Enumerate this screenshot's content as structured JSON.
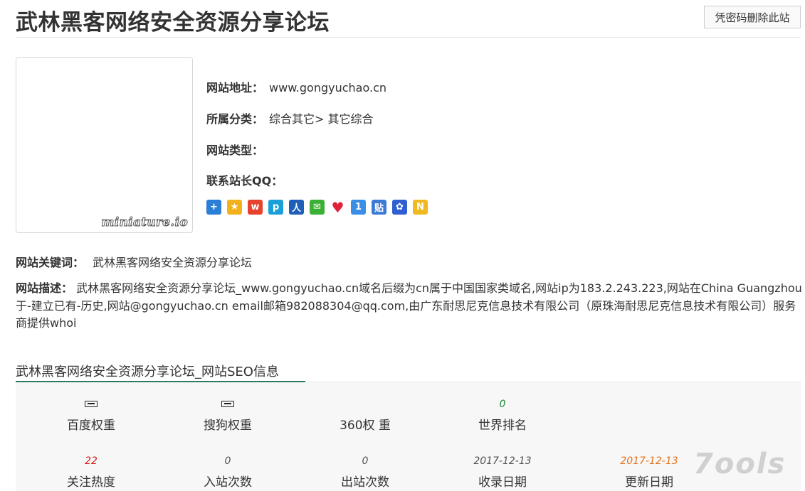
{
  "header": {
    "title": "武林黑客网络安全资源分享论坛",
    "delete_button": "凭密码删除此站"
  },
  "thumbnail": {
    "watermark": "miniature.io"
  },
  "info": {
    "address_label": "网站地址：",
    "address_value": "www.gongyuchao.cn",
    "category_label": "所属分类：",
    "category_value": "综合其它> 其它综合",
    "type_label": "网站类型：",
    "qq_label": "联系站长QQ："
  },
  "share_icons": [
    {
      "icon": "plus-share-icon",
      "glyph": "+",
      "color": "#2a7fd6"
    },
    {
      "icon": "qzone-icon",
      "glyph": "★",
      "color": "#f2b21c"
    },
    {
      "icon": "weibo-icon",
      "glyph": "w",
      "color": "#e6432e"
    },
    {
      "icon": "tqq-icon",
      "glyph": "p",
      "color": "#1a9fd8"
    },
    {
      "icon": "renren-icon",
      "glyph": "人",
      "color": "#1f5fb8"
    },
    {
      "icon": "wechat-icon",
      "glyph": "✉",
      "color": "#3cb034"
    },
    {
      "icon": "heart-icon",
      "glyph": "♥",
      "color": "#ffffff"
    },
    {
      "icon": "one-icon",
      "glyph": "1",
      "color": "#3a8ee6"
    },
    {
      "icon": "tieba-icon",
      "glyph": "贴",
      "color": "#3d7ad6"
    },
    {
      "icon": "baidu-icon",
      "glyph": "✿",
      "color": "#2f5fd0"
    },
    {
      "icon": "n-icon",
      "glyph": "N",
      "color": "#f0b920"
    }
  ],
  "keywords": {
    "label": "网站关键词：",
    "value": "武林黑客网络安全资源分享论坛"
  },
  "description": {
    "label": "网站描述：",
    "value": "武林黑客网络安全资源分享论坛_www.gongyuchao.cn域名后缀为cn属于中国国家类域名,网站ip为183.2.243.223,网站在China Guangzhou于-建立已有-历史,网站@gongyuchao.cn email邮箱982088304@qq.com,由广东耐思尼克信息技术有限公司（原珠海耐思尼克信息技术有限公司）服务商提供whoi"
  },
  "seo": {
    "title": "武林黑客网络安全资源分享论坛_网站SEO信息",
    "row1": [
      {
        "value": "",
        "label": "百度权重",
        "icon": "rank-icon",
        "color": "#222222"
      },
      {
        "value": "",
        "label": "搜狗权重",
        "icon": "rank-icon",
        "color": "#222222"
      },
      {
        "value": "",
        "label": "360权 重",
        "icon": "",
        "color": "#222222"
      },
      {
        "value": "0",
        "label": "世界排名",
        "icon": "",
        "color": "#1a8a3a"
      }
    ],
    "row2": [
      {
        "value": "22",
        "label": "关注热度",
        "color": "#d42020"
      },
      {
        "value": "0",
        "label": "入站次数",
        "color": "#555555"
      },
      {
        "value": "0",
        "label": "出站次数",
        "color": "#555555"
      },
      {
        "value": "2017-12-13",
        "label": "收录日期",
        "color": "#555555"
      },
      {
        "value": "2017-12-13",
        "label": "更新日期",
        "color": "#e8731a"
      }
    ]
  },
  "watermark": "7ools"
}
